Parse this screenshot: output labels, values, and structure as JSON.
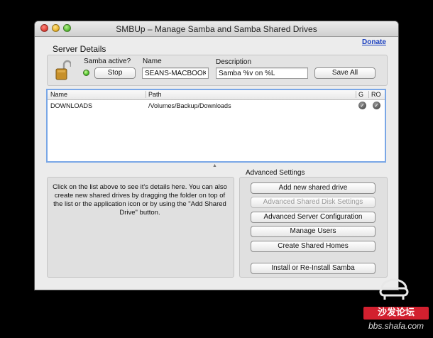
{
  "window": {
    "title": "SMBUp – Manage Samba and Samba Shared Drives"
  },
  "donate_label": "Donate",
  "server_details": {
    "section_title": "Server Details",
    "samba_active_label": "Samba active?",
    "status_color": "#4fc22b",
    "stop_button": "Stop",
    "name_label": "Name",
    "name_value": "SEANS-MACBOOK-",
    "description_label": "Description",
    "description_value": "Samba %v on %L",
    "save_all_button": "Save All"
  },
  "shares_table": {
    "columns": {
      "name": "Name",
      "path": "Path",
      "g": "G",
      "ro": "RO"
    },
    "rows": [
      {
        "name": "DOWNLOADS",
        "path": "/Volumes/Backup/Downloads",
        "g": true,
        "ro": true
      }
    ]
  },
  "info_text": "Click on the list above to see it's details here. You can also create new shared drives by dragging the folder on top of the list or the application icon or by using the \"Add Shared Drive\" button.",
  "advanced": {
    "title": "Advanced Settings",
    "add_shared_drive": "Add new shared drive",
    "advanced_shared_disk": "Advanced Shared Disk Settings",
    "advanced_server_config": "Advanced Server Configuration",
    "manage_users": "Manage Users",
    "create_shared_homes": "Create Shared Homes",
    "install_samba": "Install or Re-Install Samba"
  },
  "watermark": {
    "badge": "沙发论坛",
    "url": "bbs.shafa.com"
  }
}
